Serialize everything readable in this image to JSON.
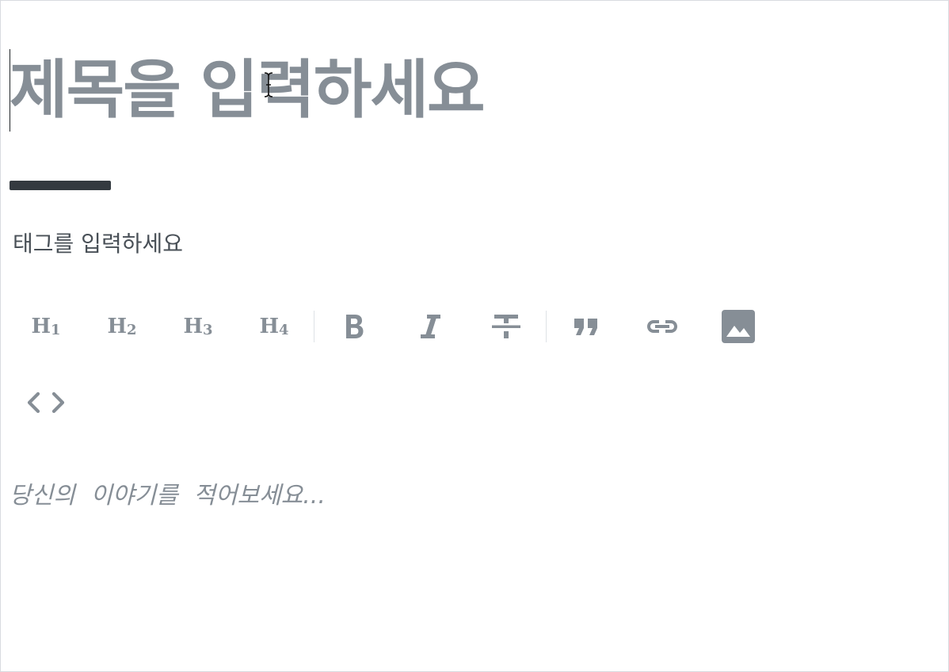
{
  "editor": {
    "title_placeholder": "제목을 입력하세요",
    "tag_placeholder": "태그를 입력하세요",
    "body_placeholder": "당신의 이야기를 적어보세요..."
  },
  "toolbar": {
    "h1": {
      "label": "H",
      "level": "1"
    },
    "h2": {
      "label": "H",
      "level": "2"
    },
    "h3": {
      "label": "H",
      "level": "3"
    },
    "h4": {
      "label": "H",
      "level": "4"
    },
    "icons": [
      "bold-icon",
      "italic-icon",
      "strikethrough-icon",
      "quote-icon",
      "link-icon",
      "image-icon",
      "code-icon"
    ]
  },
  "colors": {
    "text_muted": "#868e96",
    "divider": "#343a40",
    "tag_text": "#495057",
    "separator": "#dee2e6"
  }
}
